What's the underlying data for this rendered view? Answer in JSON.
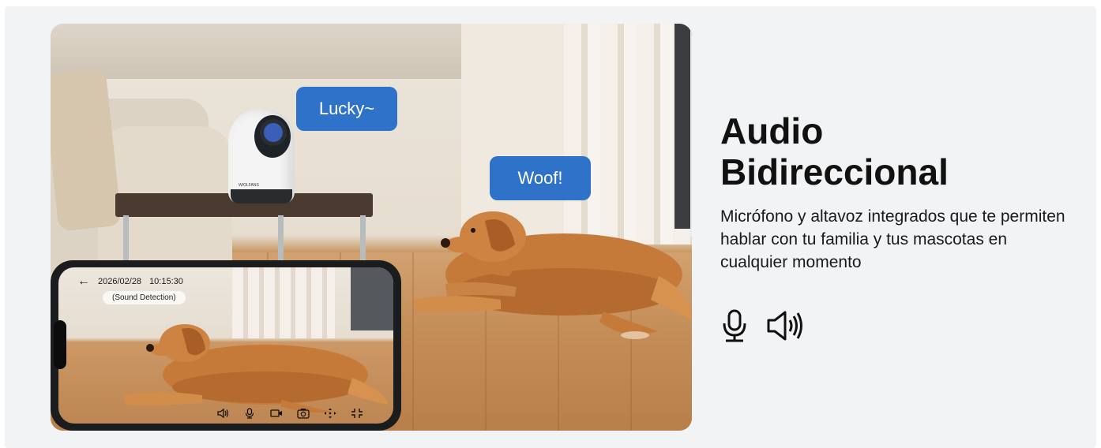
{
  "hero": {
    "bubble_lucky": "Lucky~",
    "bubble_woof": "Woof!",
    "camera_brand": "WIOLFANS"
  },
  "phone": {
    "date": "2026/02/28",
    "time": "10:15:30",
    "sound_label": "(Sound Detection)",
    "controls": [
      "speaker-icon",
      "microphone-icon",
      "record-video-icon",
      "snapshot-icon",
      "pan-tilt-icon",
      "fullscreen-icon"
    ]
  },
  "feature": {
    "title_line1": "Audio",
    "title_line2": "Bidireccional",
    "description": "Micrófono y altavoz integrados que te permiten hablar con tu familia y tus mascotas en cualquier momento",
    "icons": [
      "microphone-icon",
      "speaker-icon"
    ]
  },
  "colors": {
    "bubble_blue": "#2f72c9",
    "panel_bg": "#f2f3f5",
    "text": "#111111"
  }
}
